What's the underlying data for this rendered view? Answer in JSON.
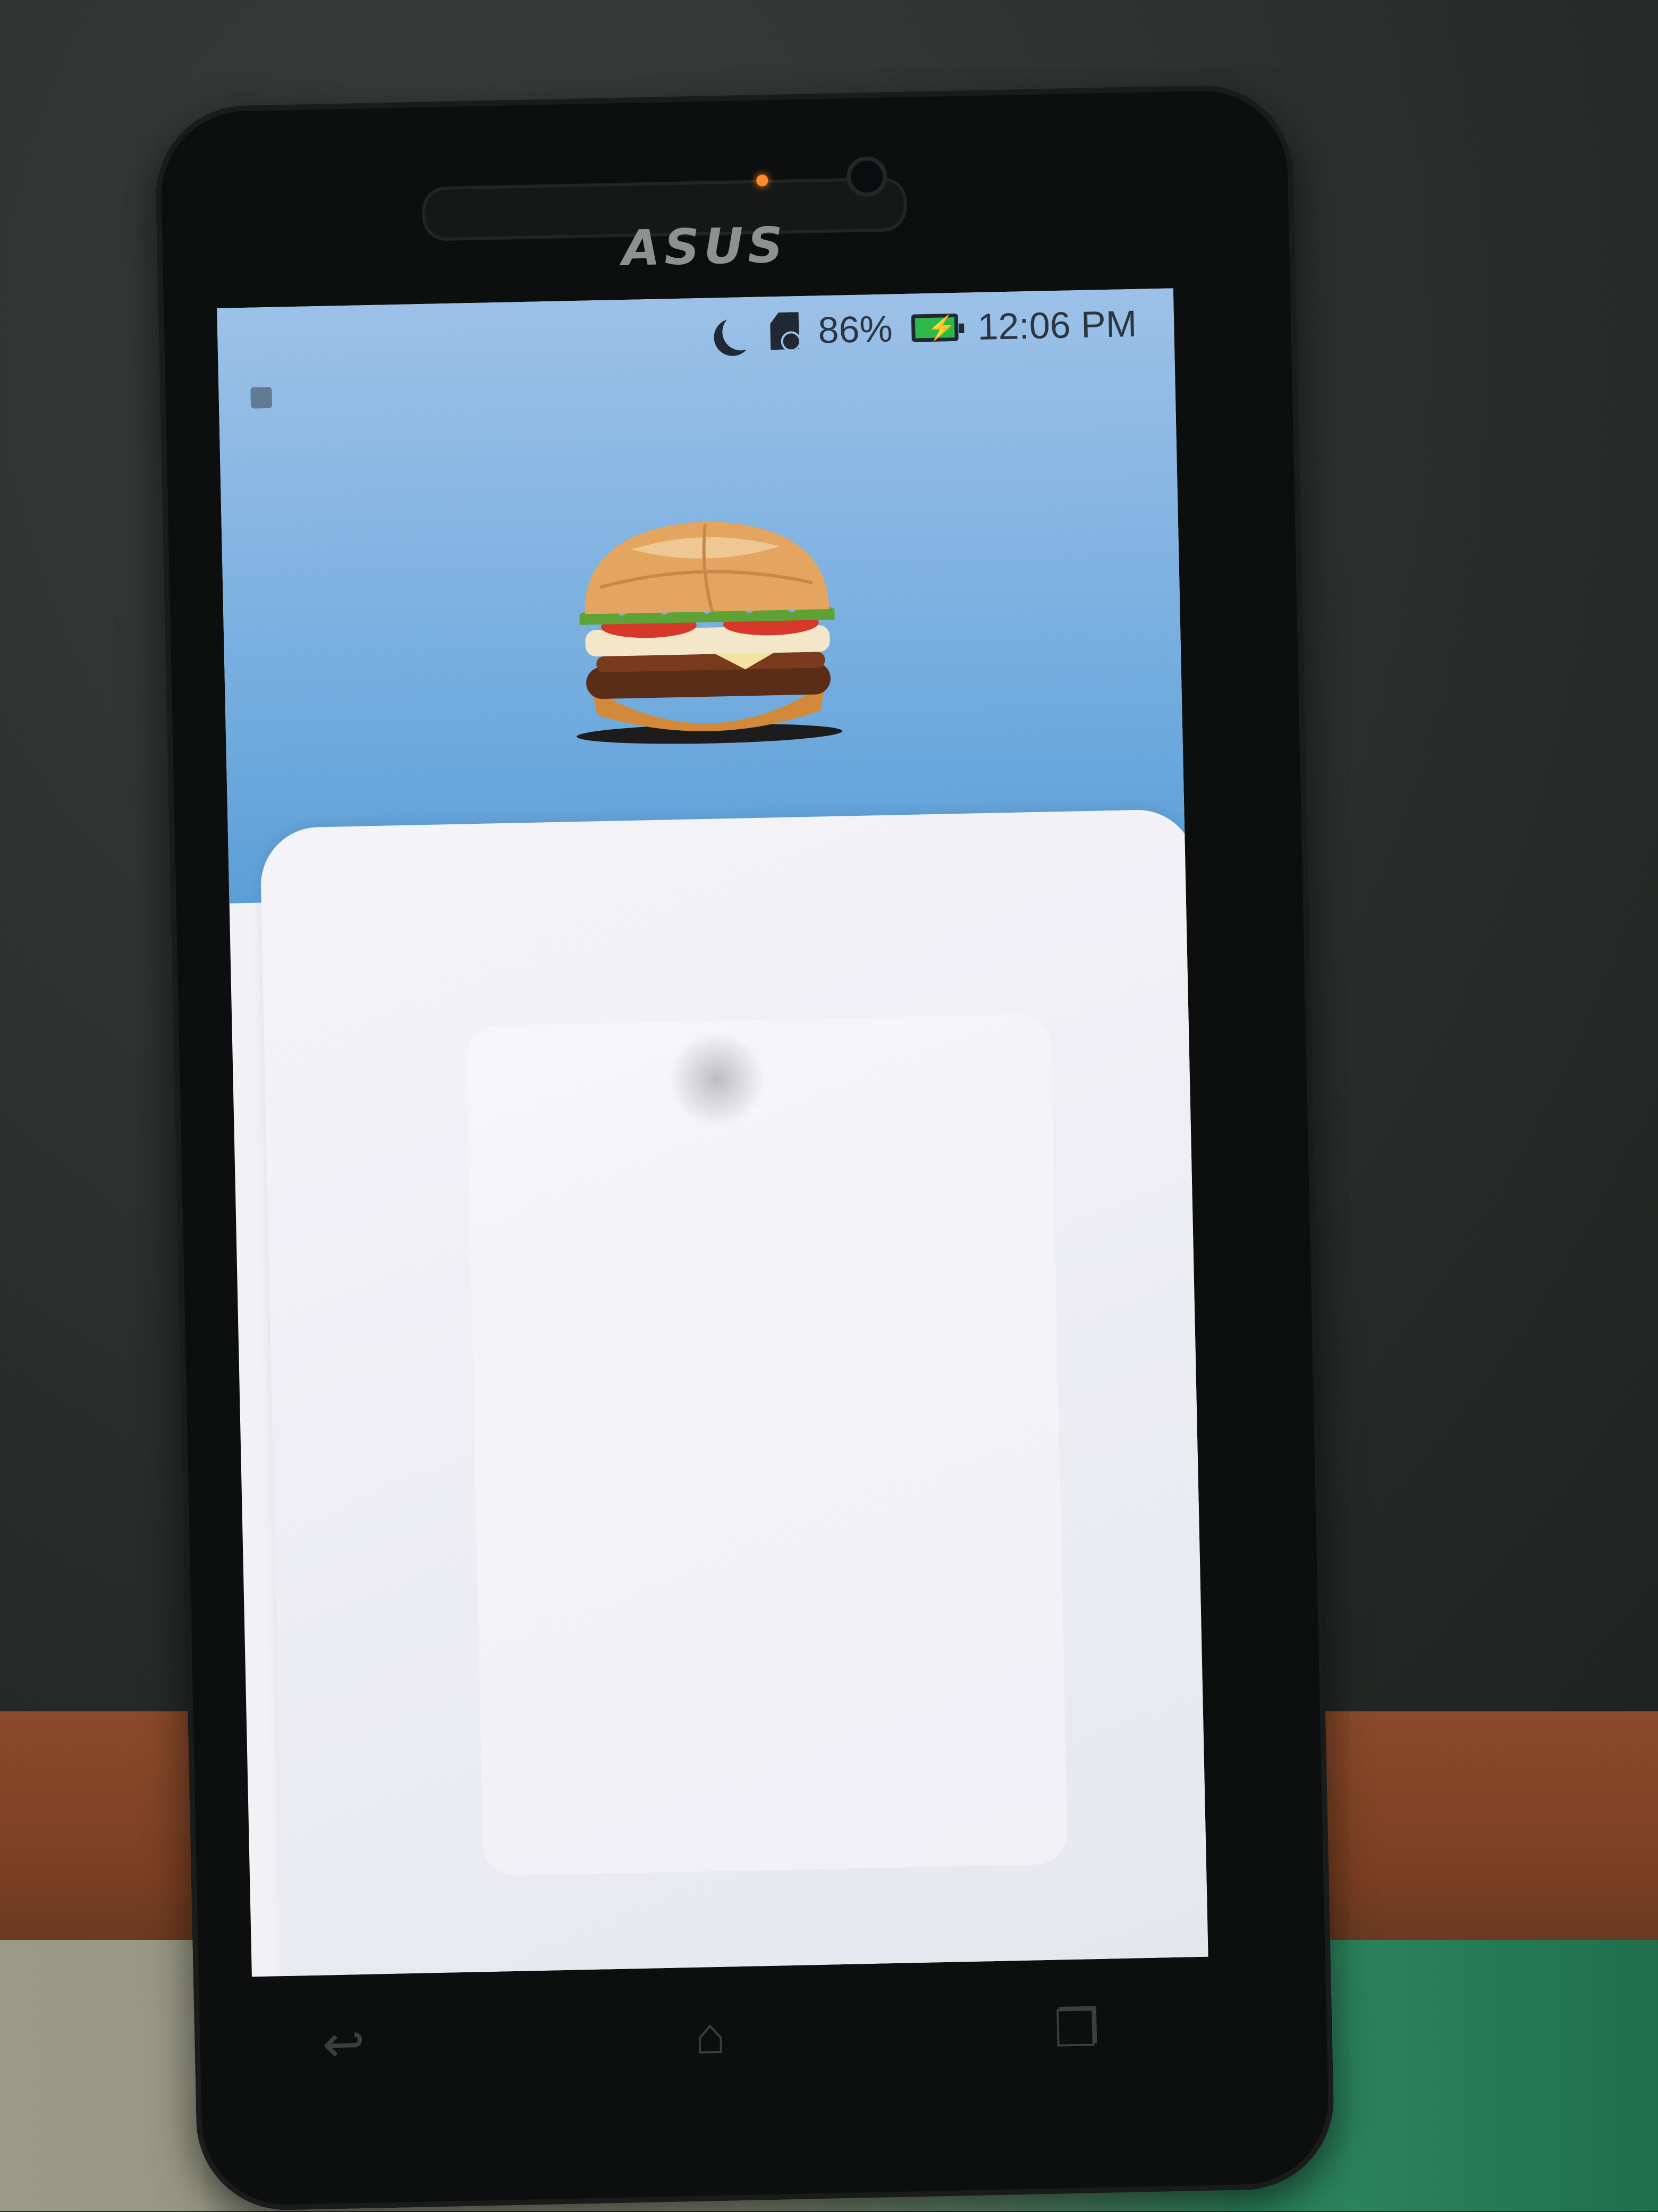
{
  "device": {
    "brand": "ASUS"
  },
  "status_bar": {
    "battery_percent": "86%",
    "time": "12:06 PM",
    "icons": [
      "moon-icon",
      "sd-card-icon",
      "battery-charging-icon"
    ]
  },
  "hero": {
    "image": "burger-image"
  },
  "nav_bar": {
    "back_glyph": "↩",
    "home_glyph": "⌂",
    "recents_glyph": "❐"
  },
  "colors": {
    "hero_sky": "#7ab0e0",
    "card": "#f1f1f6",
    "battery": "#2db84a"
  }
}
